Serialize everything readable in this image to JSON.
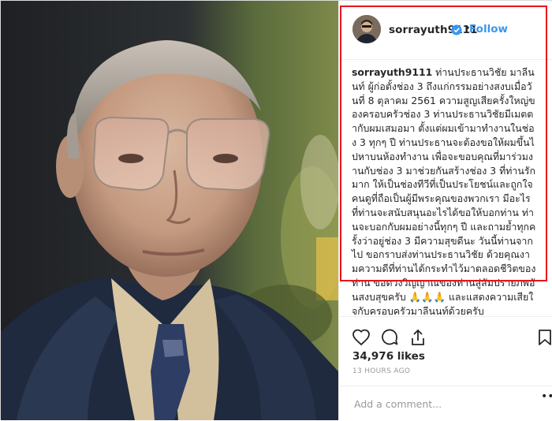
{
  "post": {
    "username": "sorrayuth9111",
    "dot": "•",
    "follow_label": "Follow",
    "caption_user": "sorrayuth9111",
    "caption_text": " ท่านประธานวิชัย มาลีนนท์ ผู้ก่อตั้งช่อง 3 ถึงแก่กรรมอย่างสงบเมื่อวันที่ 8 ตุลาคม 2561 ความสูญเสียครั้งใหญ่ของครอบครัวช่อง 3 ท่านประธานวิชัยมีเมตตากับผมเสมอมา ตั้งแต่ผมเข้ามาทำงานในช่อง 3 ทุกๆ ปี ท่านประธานจะต้องขอให้ผมขึ้นไปหาบนห้องทำงาน เพื่อจะขอบคุณที่มาร่วมงานกับช่อง 3 มาช่วยกันสร้างช่อง 3 ที่ท่านรักมาก ให้เป็นช่องทีวีที่เป็นประโยชน์และถูกใจคนดูที่ถือเป็นผู้มีพระคุณของพวกเรา มีอะไรที่ท่านจะสนับสนุนอะไรได้ขอให้บอกท่าน ท่านจะบอกกับผมอย่างนี้ทุกๆ ปี และถามย้ำทุกครั้งว่าอยู่ช่อง 3 มีความสุขดีนะ วันนี้ท่านจากไป ขอกราบส่งท่านประธานวิชัย ด้วยคุณงามความดีที่ท่านได้กระทำไว้มาตลอดชีวิตของท่าน ขอดวงวิญญาณของท่านสู่สัมปรายภพอันสงบสุขครับ 🙏🙏🙏 และแสดงความเสียใจกับครอบครัวมาลีนนท์ด้วยครับ",
    "likes": "34,976 likes",
    "timestamp": "13 HOURS AGO",
    "comment_placeholder": "Add a comment...",
    "more": "•••"
  },
  "icons": {
    "verified": "verified-badge-icon",
    "like": "heart-icon",
    "comment": "comment-icon",
    "share": "share-icon",
    "save": "bookmark-icon"
  },
  "colors": {
    "link_blue": "#3897f0",
    "highlight_red": "#e8141c",
    "text": "#262626",
    "muted": "#999999"
  }
}
